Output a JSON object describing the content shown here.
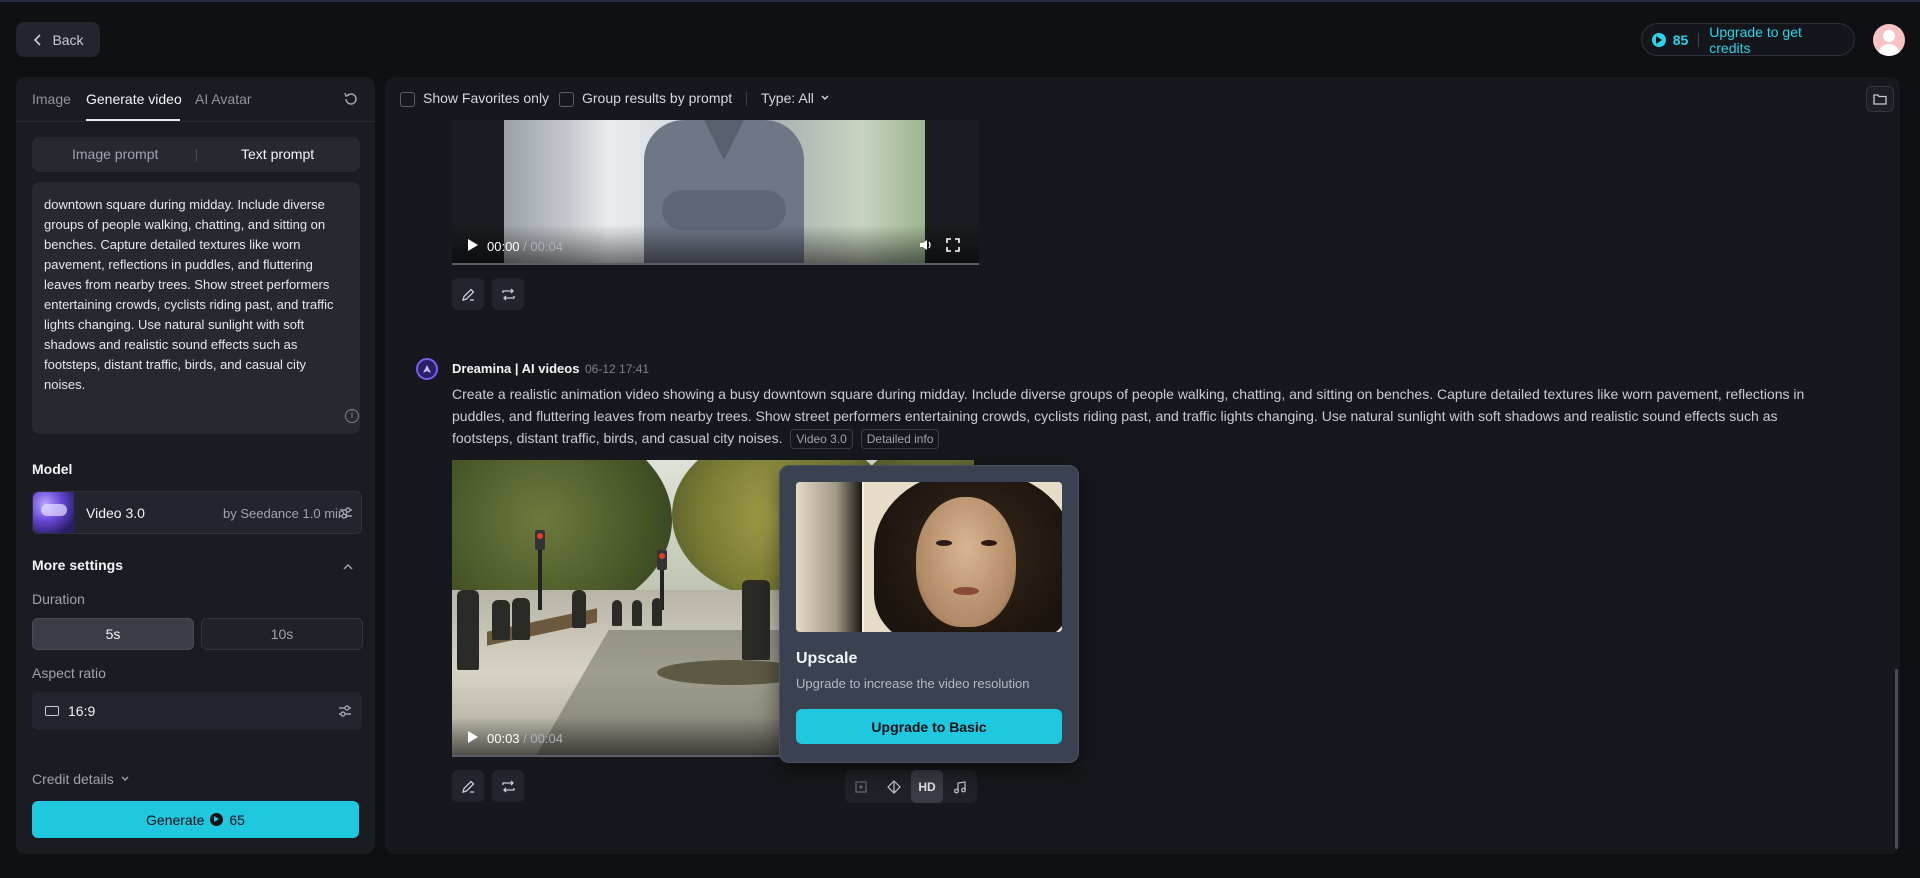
{
  "header": {
    "back_label": "Back",
    "credits_count": "85",
    "upgrade_label": "Upgrade to get credits"
  },
  "left_panel": {
    "tabs": [
      {
        "label": "Image"
      },
      {
        "label": "Generate video"
      },
      {
        "label": "AI Avatar"
      }
    ],
    "prompt_modes": {
      "image": "Image prompt",
      "text": "Text prompt"
    },
    "prompt_text": "downtown square during midday. Include diverse groups of people walking, chatting, and sitting on benches. Capture detailed textures like worn pavement, reflections in puddles, and fluttering leaves from nearby trees. Show street performers entertaining crowds, cyclists riding past, and traffic lights changing. Use natural sunlight with soft shadows and realistic sound effects such as footsteps, distant traffic, birds, and casual city noises.",
    "model_label": "Model",
    "model": {
      "name": "Video 3.0",
      "by": "by Seedance 1.0 mini"
    },
    "more_settings_label": "More settings",
    "duration_label": "Duration",
    "duration_options": [
      "5s",
      "10s"
    ],
    "aspect_label": "Aspect ratio",
    "aspect_value": "16:9",
    "credit_details_label": "Credit details",
    "generate_label": "Generate",
    "generate_cost": "65"
  },
  "filters": {
    "favorites_label": "Show Favorites only",
    "group_label": "Group results by prompt",
    "type_label": "Type: All"
  },
  "video1": {
    "time_current": "00:00",
    "time_total": "/ 00:04"
  },
  "entry": {
    "author": "Dreamina | AI videos",
    "date": "06-12  17:41",
    "description": "Create a realistic animation video showing a busy downtown square during midday. Include diverse groups of people walking, chatting, and sitting on benches. Capture detailed textures like worn pavement, reflections in puddles, and fluttering leaves from nearby trees. Show street performers entertaining crowds, cyclists riding past, and traffic lights changing. Use natural sunlight with soft shadows and realistic sound effects such as footsteps, distant traffic, birds, and casual city noises.",
    "tag_model": "Video 3.0",
    "tag_details": "Detailed info"
  },
  "video2": {
    "time_current": "00:03",
    "time_total": "/ 00:04",
    "hd_label": "HD"
  },
  "popover": {
    "title": "Upscale",
    "subtitle": "Upgrade to increase the video resolution",
    "button_label": "Upgrade to Basic"
  },
  "colors": {
    "accent": "#1fc8df",
    "background": "#0f1014",
    "panel": "#1a1c22"
  }
}
